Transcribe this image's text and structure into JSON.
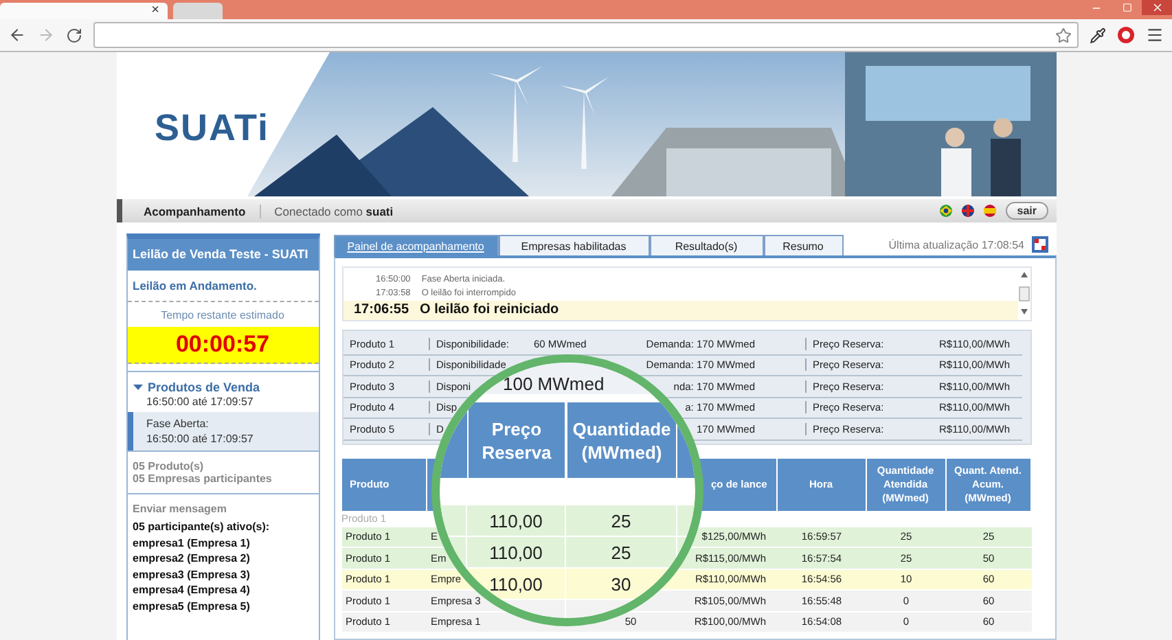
{
  "browser": {
    "tab_close": "×"
  },
  "logo": "SUATi",
  "nav": {
    "items": [
      {
        "label": "Acompanhamento",
        "selected": true
      }
    ],
    "connected": "Conectado como **suati**",
    "logout": "sair"
  },
  "auction": {
    "title": "Leilão de Venda Teste - SUATI",
    "status": "Leilão em Andamento.",
    "timer_label": "Tempo restante estimado",
    "timer": "00:00:57",
    "products": {
      "title": "Produtos de Venda",
      "expanded": true,
      "period": "16:50:00 até 17:09:57",
      "phase_label": "Fase Aberta:",
      "phase_period": "16:50:00 até 17:09:57"
    },
    "summary": [
      "05 Produto(s)",
      "05 Empresas participantes"
    ],
    "message_link": "Enviar mensagem",
    "active_label": "05 participante(s) ativo(s):",
    "participants": [
      "empresa1 (Empresa 1)",
      "empresa2 (Empresa 2)",
      "empresa3 (Empresa 3)",
      "empresa4 (Empresa 4)",
      "empresa5 (Empresa 5)"
    ]
  },
  "tabs": [
    {
      "label": "Painel de acompanhamento",
      "selected": true
    },
    {
      "label": "Empresas habilitadas",
      "selected": false
    },
    {
      "label": "Resultado(s)",
      "selected": false
    },
    {
      "label": "Resumo",
      "selected": false
    }
  ],
  "last_update": "Última atualização 17:08:54",
  "log": [
    {
      "time": "16:50:00",
      "message": "Fase Aberta iniciada.",
      "current": false
    },
    {
      "time": "17:03:58",
      "message": "O leilão foi interrompido",
      "current": false
    },
    {
      "time": "17:06:55",
      "message": "O leilão foi reiniciado",
      "current": true
    }
  ],
  "products": [
    {
      "product": "Produto 1",
      "availability_label": "Disponibilidade:",
      "availability_value": "60 MWmed",
      "demand": "Demanda: 170 MWmed",
      "reserve_label": "Preço Reserva:",
      "reserve_value": "R$110,00/MWh"
    },
    {
      "product": "Produto 2",
      "availability_label": "Disponibilidade",
      "demand": "Demanda: 170 MWmed",
      "reserve_label": "Preço Reserva:",
      "reserve_value": "R$110,00/MWh"
    },
    {
      "product": "Produto 3",
      "availability_label": "Disponi",
      "demand": "nda: 170 MWmed",
      "reserve_label": "Preço Reserva:",
      "reserve_value": "R$110,00/MWh"
    },
    {
      "product": "Produto 4",
      "availability_label": "Disp",
      "demand": "a: 170 MWmed",
      "reserve_label": "Preço Reserva:",
      "reserve_value": "R$110,00/MWh"
    },
    {
      "product": "Produto 5",
      "availability_label": "D",
      "demand": "170 MWmed",
      "reserve_label": "Preço Reserva:",
      "reserve_value": "R$110,00/MWh"
    }
  ],
  "bids": {
    "columns": [
      "Produto",
      "",
      "",
      "",
      "ço de lance",
      "Hora",
      "Quantidade Atendida (MWmed)",
      "Quant. Atend. Acum. (MWmed)"
    ],
    "rows": [
      {
        "kind": "group",
        "label": "Produto 1"
      },
      {
        "kind": "bid",
        "color": "#e0f2d8",
        "product": "Produto 1",
        "company": "E",
        "price": "$125,00/MWh",
        "time": "16:59:57",
        "served": "25",
        "accumulated": "25"
      },
      {
        "kind": "bid",
        "color": "#e0f2d8",
        "product": "Produto 1",
        "company": "Em",
        "price": "R$115,00/MWh",
        "time": "16:57:54",
        "served": "25",
        "accumulated": "50"
      },
      {
        "kind": "bid",
        "color": "#fdfbd2",
        "product": "Produto 1",
        "company": "Empre",
        "price": "R$110,00/MWh",
        "time": "16:54:56",
        "served": "10",
        "accumulated": "60"
      },
      {
        "kind": "bid",
        "color": "#f2f2f2",
        "product": "Produto 1",
        "company": "Empresa 3",
        "price": "R$105,00/MWh",
        "time": "16:55:48",
        "served": "0",
        "accumulated": "60"
      },
      {
        "kind": "bid",
        "color": "#f2f2f2",
        "product": "Produto 1",
        "company": "Empresa 1",
        "quantity": "50",
        "price": "R$100,00/MWh",
        "time": "16:54:08",
        "served": "0",
        "accumulated": "60"
      }
    ]
  },
  "magnifier": {
    "caption": "100 MWmed",
    "columns": [
      "Preço Reserva",
      "Quantidade (MWmed)"
    ],
    "rows": [
      {
        "color": "#e0f2d8",
        "price": "110,00",
        "quantity": "25"
      },
      {
        "color": "#e0f2d8",
        "price": "110,00",
        "quantity": "25"
      },
      {
        "color": "#fdfbd2",
        "price": "110,00",
        "quantity": "30"
      },
      {
        "color": "#f2f2f2"
      }
    ]
  }
}
